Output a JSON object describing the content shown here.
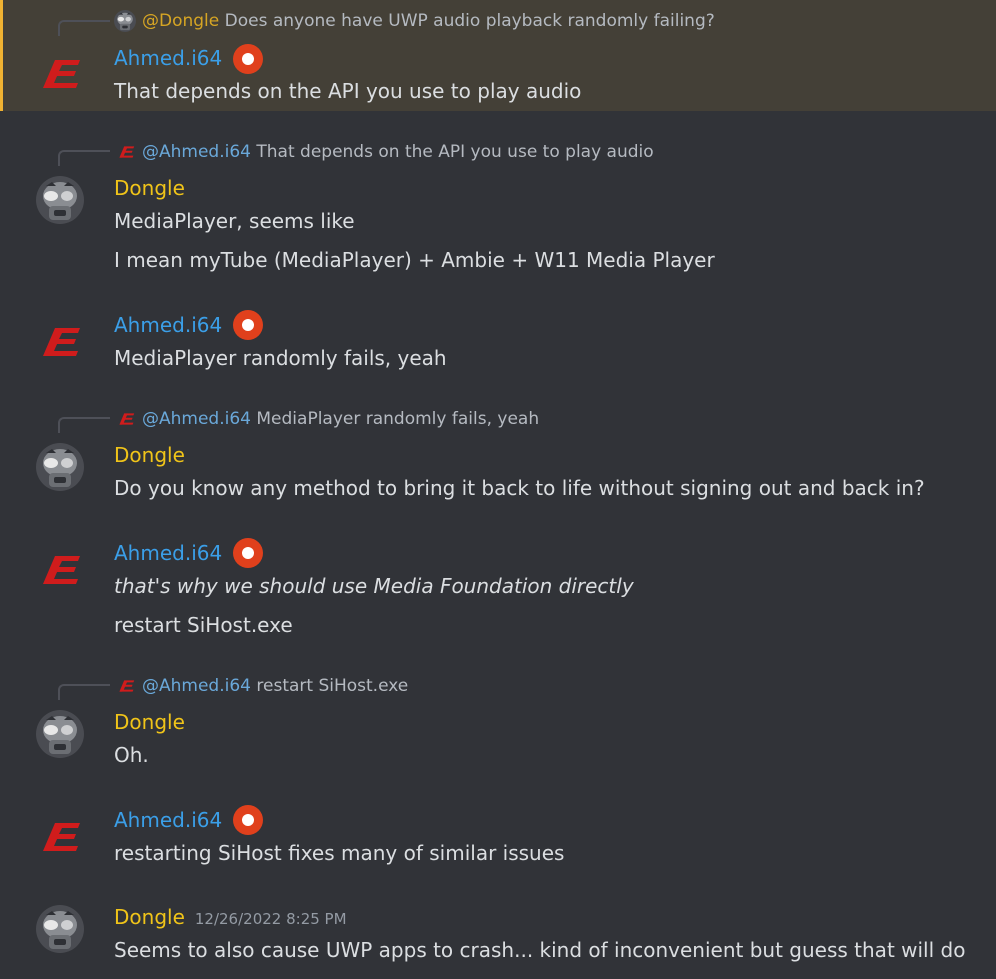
{
  "theme": {
    "ahmed_color": "#3b9fe8",
    "dongle_color": "#f0c419",
    "background": "#313338",
    "highlight": "#444037"
  },
  "messages": [
    {
      "author": "Ahmed.i64",
      "reply_mention": "@Dongle",
      "reply_text": "Does anyone have UWP audio playback randomly failing?",
      "lines": [
        "That depends on the API you use to play audio"
      ]
    },
    {
      "author": "Dongle",
      "reply_mention": "@Ahmed.i64",
      "reply_text": "That depends on the API you use to play audio",
      "lines": [
        "MediaPlayer, seems like",
        "I mean myTube (MediaPlayer) + Ambie + W11 Media Player"
      ]
    },
    {
      "author": "Ahmed.i64",
      "lines": [
        "MediaPlayer randomly fails, yeah"
      ]
    },
    {
      "author": "Dongle",
      "reply_mention": "@Ahmed.i64",
      "reply_text": "MediaPlayer randomly fails, yeah",
      "lines": [
        "Do you know any method to bring it back to life without signing out and back in?"
      ]
    },
    {
      "author": "Ahmed.i64",
      "lines": [
        "that's why we should use Media Foundation directly",
        "restart SiHost.exe"
      ]
    },
    {
      "author": "Dongle",
      "reply_mention": "@Ahmed.i64",
      "reply_text": "restart SiHost.exe",
      "lines": [
        "Oh."
      ]
    },
    {
      "author": "Ahmed.i64",
      "lines": [
        "restarting SiHost fixes many of similar issues"
      ]
    },
    {
      "author": "Dongle",
      "timestamp": "12/26/2022 8:25 PM",
      "lines": [
        "Seems to also cause UWP apps to crash... kind of inconvenient but guess that will do"
      ]
    }
  ]
}
